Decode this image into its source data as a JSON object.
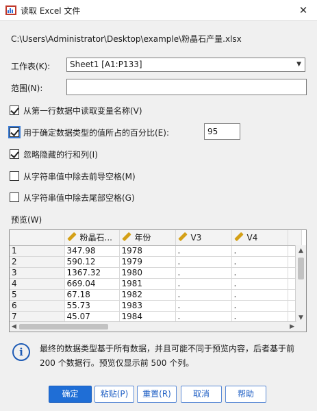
{
  "window": {
    "title": "读取 Excel 文件",
    "close_glyph": "✕"
  },
  "file_path": "C:\\Users\\Administrator\\Desktop\\example\\粉晶石产量.xlsx",
  "worksheet": {
    "label": "工作表(K):",
    "value": "Sheet1 [A1:P133]"
  },
  "range": {
    "label": "范围(N):",
    "value": ""
  },
  "options": [
    {
      "label": "从第一行数据中读取变量名称(V)",
      "checked": true
    },
    {
      "label": "用于确定数据类型的值所占的百分比(E):",
      "checked": true,
      "value": "95"
    },
    {
      "label": "忽略隐藏的行和列(I)",
      "checked": true
    },
    {
      "label": "从字符串值中除去前导空格(M)",
      "checked": false
    },
    {
      "label": "从字符串值中除去尾部空格(G)",
      "checked": false
    }
  ],
  "preview": {
    "label": "预览(W)",
    "columns": [
      "粉晶石...",
      "年份",
      "V3",
      "V4"
    ],
    "rows": [
      [
        "1",
        "347.98",
        "1978",
        ".",
        "."
      ],
      [
        "2",
        "590.12",
        "1979",
        ".",
        "."
      ],
      [
        "3",
        "1367.32",
        "1980",
        ".",
        "."
      ],
      [
        "4",
        "669.04",
        "1981",
        ".",
        "."
      ],
      [
        "5",
        "67.18",
        "1982",
        ".",
        "."
      ],
      [
        "6",
        "55.73",
        "1983",
        ".",
        "."
      ],
      [
        "7",
        "45.07",
        "1984",
        ".",
        "."
      ]
    ]
  },
  "info": {
    "icon": "info-icon",
    "text": "最终的数据类型基于所有数据，并且可能不同于预览内容，后者基于前 200 个数据行。预览仅显示前 500 个列。"
  },
  "buttons": {
    "ok": "确定",
    "paste": "粘贴(P)",
    "reset": "重置(R)",
    "cancel": "取消",
    "help": "帮助"
  }
}
